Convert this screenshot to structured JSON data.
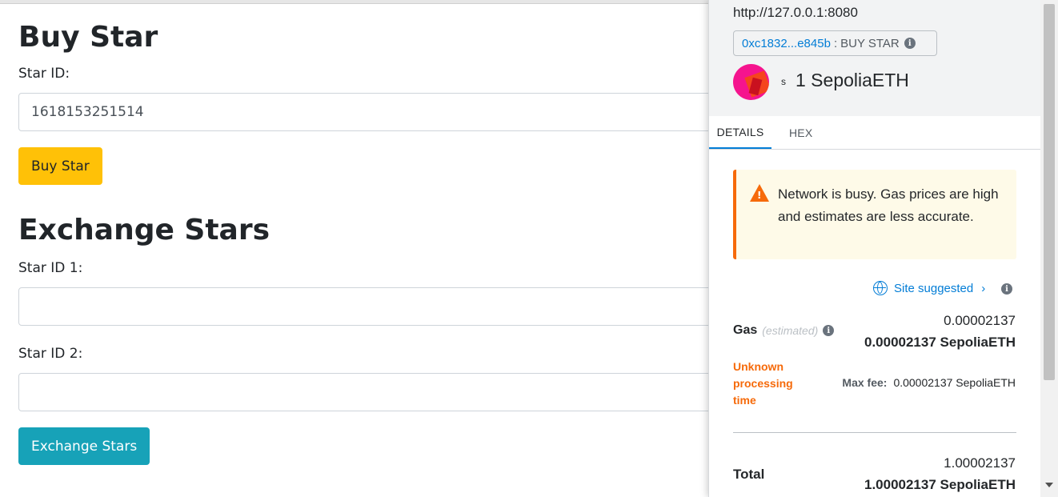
{
  "dapp": {
    "buy_heading": "Buy Star",
    "star_id_label": "Star ID:",
    "star_id_value": "1618153251514",
    "buy_button": "Buy Star",
    "exchange_heading": "Exchange Stars",
    "star_id1_label": "Star ID 1:",
    "star_id1_value": "",
    "star_id2_label": "Star ID 2:",
    "star_id2_value": "",
    "exchange_button": "Exchange Stars"
  },
  "metamask": {
    "origin": "http://127.0.0.1:8080",
    "contract_address": "0xc1832...e845b",
    "separator": ":",
    "method": "BUY STAR",
    "amount_prefix": "s",
    "amount": "1 SepoliaETH",
    "tabs": [
      {
        "label": "DETAILS",
        "active": true
      },
      {
        "label": "HEX",
        "active": false
      }
    ],
    "warning": "Network is busy. Gas prices are high and estimates are less accurate.",
    "site_suggested": "Site suggested",
    "gas": {
      "label": "Gas",
      "estimated": "(estimated)",
      "value": "0.00002137",
      "value_with_unit": "0.00002137 SepoliaETH",
      "processing_time": "Unknown processing time",
      "max_fee_label": "Max fee:",
      "max_fee_value": "0.00002137 SepoliaETH"
    },
    "total": {
      "label": "Total",
      "value": "1.00002137",
      "value_with_unit": "1.00002137 SepoliaETH"
    }
  },
  "colors": {
    "warning_button": "#ffc107",
    "info_button": "#17a2b8",
    "link_blue": "#037dd6",
    "alert_orange": "#f66a0a"
  }
}
